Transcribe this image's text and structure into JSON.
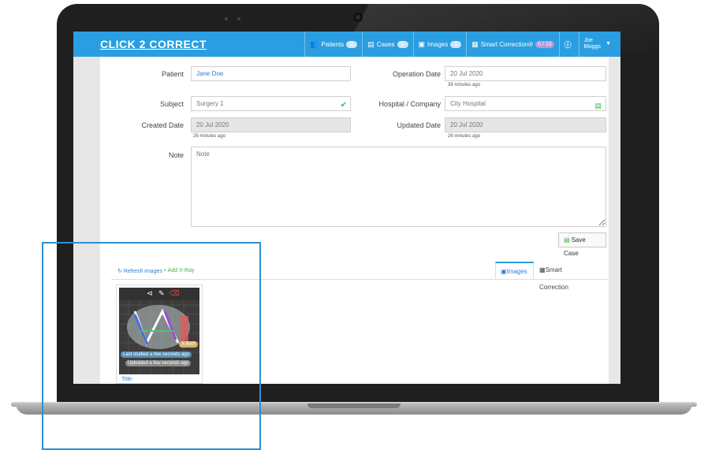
{
  "app": {
    "brand": "CLICK 2 CORRECT"
  },
  "nav": {
    "items": [
      {
        "label": "Patients",
        "badge": "2",
        "icon": "users-icon"
      },
      {
        "label": "Cases",
        "badge": "1",
        "icon": "briefcase-icon"
      },
      {
        "label": "Images",
        "badge": "1",
        "icon": "image-icon"
      },
      {
        "label": "Smart Correction®",
        "badge": "0 / 10",
        "icon": "correction-icon"
      }
    ],
    "info_icon": "info-icon",
    "user_first": "Joe",
    "user_last": "Bloggs"
  },
  "form": {
    "patient_label": "Patient",
    "patient_value": "Jane Doe",
    "operation_date_label": "Operation Date",
    "operation_date_value": "20 Jul 2020",
    "operation_date_hint": "39 minutes ago",
    "subject_label": "Subject",
    "subject_value": "Surgery 1",
    "hospital_label": "Hospital / Company",
    "hospital_value": "City Hospital",
    "created_label": "Created Date",
    "created_value": "20 Jul 2020",
    "created_hint": "26 minutes ago",
    "updated_label": "Updated Date",
    "updated_value": "20 Jul 2020",
    "updated_hint": "26 minutes ago",
    "note_label": "Note",
    "note_placeholder": "Note",
    "save_label": "Save Case"
  },
  "images_section": {
    "refresh_label": "Refresh images",
    "add_label": "+ Add X-Ray",
    "tab_images": "Images",
    "tab_smart": "Smart Correction",
    "thumb": {
      "type_tag": "X-RAY",
      "studied": "Last studied a few seconds ago",
      "uploaded": "Uploaded a few seconds ago",
      "title_label": "Title:"
    }
  },
  "colors": {
    "brand_blue": "#2a9ee0",
    "success_green": "#3bb54a",
    "highlight": "#2d8fd5"
  }
}
